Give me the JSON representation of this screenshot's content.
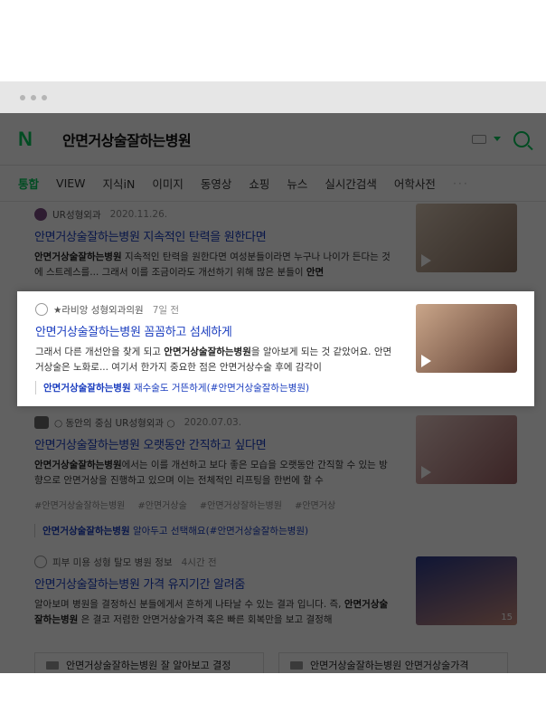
{
  "search": {
    "query": "안면거상술잘하는병원",
    "logo": "N"
  },
  "tabs": [
    "통합",
    "VIEW",
    "지식iN",
    "이미지",
    "동영상",
    "쇼핑",
    "뉴스",
    "실시간검색",
    "어학사전"
  ],
  "tabs_more": "···",
  "results": [
    {
      "author": "UR성형외과",
      "time": "2020.11.26.",
      "title": "안면거상술잘하는병원 지속적인 탄력을 원한다면",
      "desc_bold1": "안면거상술잘하는병원",
      "desc1": " 지속적인 탄력을 원한다면 여성분들이라면 누구나 나이가 든다는 것에 스트레스를... 그래서 이를 조금이라도 개선하기 위해 많은 분들이 ",
      "desc_bold2": "안면"
    },
    {
      "author": "★라비앙 성형외과의원",
      "time": "7일 전",
      "title": "안면거상술잘하는병원 꼼꼼하고 섬세하게",
      "desc1": "그래서 다른 개선안을 찾게 되고 ",
      "desc_bold1": "안면거상술잘하는병원",
      "desc2": "을 알아보게 되는 것 같았어요. 안면거상술은 노화로... 여기서 한가지 중요한 점은 안면거상수술 후에 감각이",
      "sub_bold": "안면거상술잘하는병원",
      "sub": " 재수술도 거뜬하게(#안면거상술잘하는병원)"
    },
    {
      "author": "○ 동안의 중심 UR성형외과 ○",
      "time": "2020.07.03.",
      "title": "안면거상술잘하는병원 오랫동안 간직하고 싶다면",
      "desc_bold1": "안면거상술잘하는병원",
      "desc1": "에서는 이를 개선하고 보다 좋은 모습을 오랫동안 간직할 수 있는 방향으로 안면거상을 진행하고 있으며 이는 전체적인 리프팅을 한번에 할 수",
      "tags": [
        "#안면거상술잘하는병원",
        "#안면거상술",
        "#안면거상잘하는병원",
        "#안면거상"
      ],
      "sub_bold": "안면거상술잘하는병원",
      "sub": " 알아두고 선택해요(#안면거상술잘하는병원)"
    },
    {
      "author": "피부 미용 성형 탈모 병원 정보",
      "time": "4시간 전",
      "title": "안면거상술잘하는병원 가격 유지기간 알려줌",
      "desc1": "알아보며 병원을 결정하신 분들에게서 흔하게 나타날 수 있는 결과 입니다. 즉, ",
      "desc_bold1": "안면거상술잘하는병원",
      "desc2": " 은 결코 저렴한 안면거상술가격 혹은 빠른 회복만을 보고 결정해",
      "thumb_count": "15"
    }
  ],
  "bottom_cards": [
    "안면거상술잘하는병원 잘 알아보고 결정",
    "안면거상술잘하는병원 안면거상술가격"
  ],
  "colors": {
    "brand": "#03c75a",
    "link": "#1a3dbf"
  }
}
